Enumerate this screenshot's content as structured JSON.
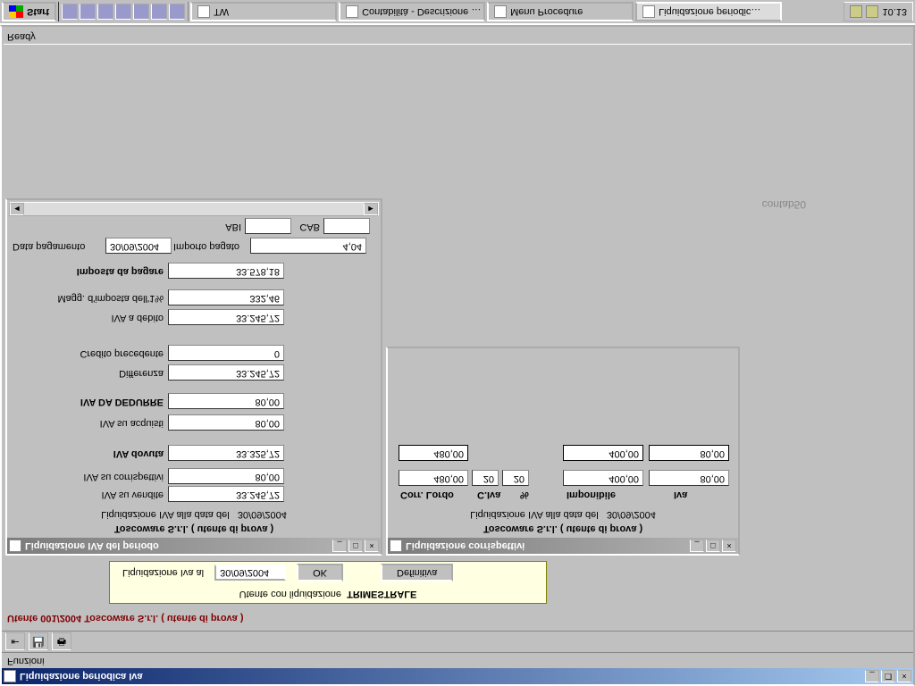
{
  "main_window": {
    "title": "Liquidazione periodica Iva",
    "menu": "Funzioni",
    "user_line": "Utente 001/2004 Toscoware S.r.l. ( utente di prova )",
    "panel": {
      "label": "Utente con liquidazione",
      "mode": "TRIMESTRALE",
      "liq_label": "Liquidazione Iva al",
      "date": "30/09/2004",
      "ok": "OK",
      "definitiva": "Definitiva"
    },
    "watermark": "contab50",
    "status": "Ready"
  },
  "win_left": {
    "title": "Liquidazione IVA del periodo",
    "head": "Toscoware S.r.l. ( utente di prova )",
    "sub_label": "Liquidazione IVA alla data del",
    "sub_date": "30/09/2004",
    "rows": {
      "iva_vendite_l": "IVA su vendite",
      "iva_vendite_v": "33.245,72",
      "iva_corr_l": "IVA su corrispettivi",
      "iva_corr_v": "80,00",
      "iva_dovuta_l": "IVA dovuta",
      "iva_dovuta_v": "33.325,72",
      "iva_acq_l": "IVA su acquisti",
      "iva_acq_v": "80,00",
      "iva_dedurre_l": "IVA DA DEDURRE",
      "iva_dedurre_v": "80,00",
      "diff_l": "Differenza",
      "diff_v": "33.245,72",
      "credprec_l": "Credito precedente",
      "credprec_v": "0",
      "iva_deb_l": "IVA a debito",
      "iva_deb_v": "33.245,72",
      "magg_l": "Magg. d'imposta dell'1%",
      "magg_v": "332,46",
      "imposta_l": "Imposta da pagare",
      "imposta_v": "33.578,18",
      "data_pag_l": "Data pagamento",
      "data_pag_v": "30/09/2004",
      "imp_pag_l": "Importo pagato",
      "imp_pag_v": "4,04",
      "abi_l": "ABI",
      "cab_l": "CAB"
    }
  },
  "win_right": {
    "title": "Liquidazione corrispettivi",
    "head": "Toscoware S.r.l. ( utente di prova )",
    "sub_label": "Liquidazione IVA alla data del",
    "sub_date": "30/09/2004",
    "cols": {
      "c1": "Corr. Lordo",
      "c2": "C.Iva",
      "c3": "%",
      "c4": "Imponibile",
      "c5": "Iva"
    },
    "row": {
      "lordo": "480,00",
      "civa": "20",
      "pct": "20",
      "impon": "400,00",
      "iva": "80,00"
    },
    "tot": {
      "lordo": "480,00",
      "impon": "400,00",
      "iva": "80,00"
    }
  },
  "taskbar": {
    "start": "Start",
    "tasks": [
      "TW",
      "Contabilità - Descrizione …",
      "Menu Procedure",
      "Liquidazione periodic…"
    ],
    "clock": "10.13"
  }
}
